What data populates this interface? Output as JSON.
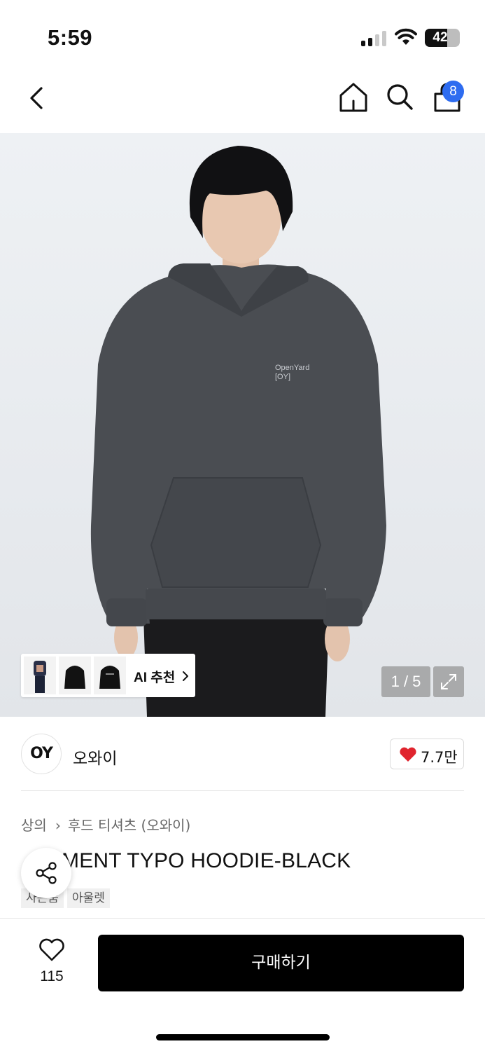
{
  "status_bar": {
    "time": "5:59",
    "battery": "42"
  },
  "nav": {
    "cart_count": "8"
  },
  "hero": {
    "ai_label": "AI 추천",
    "pager": "1 / 5",
    "hoodie_print_line1": "OpenYard",
    "hoodie_print_line2": "[OY]",
    "colors": {
      "background": "#e9ecef",
      "hoodie": "#4a4d52",
      "pants": "#1b1b1d"
    }
  },
  "brand": {
    "logo_text": "OY",
    "name": "오와이",
    "likes": "7.7만"
  },
  "product": {
    "breadcrumb": [
      "상의",
      "후드 티셔츠 (오와이)"
    ],
    "title": "MENT TYPO HOODIE-BLACK",
    "tags": [
      "사은품",
      "아울렛"
    ]
  },
  "bottom_bar": {
    "wish_count": "115",
    "buy_label": "구매하기"
  },
  "accent": {
    "badge": "#2e6cf0",
    "heart": "#e0242e"
  }
}
